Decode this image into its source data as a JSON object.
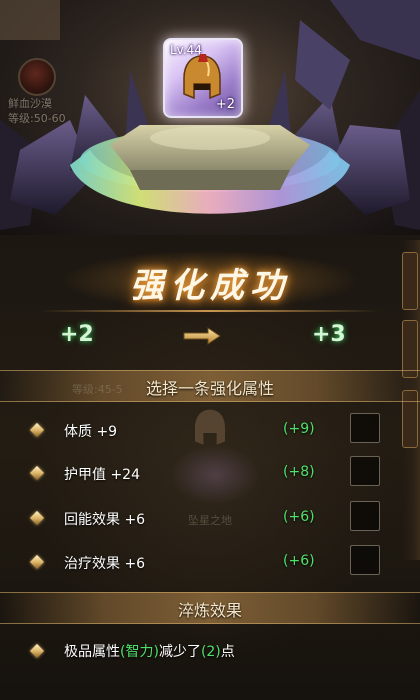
{
  "background": {
    "player_name": "鲜血沙漠",
    "player_level": "等级:50-60",
    "zone_level": "等级:45-5",
    "zone_name": "坠星之地"
  },
  "item": {
    "level": "Lv.44",
    "enhance": "+2",
    "icon": "golden-helmet-icon"
  },
  "result": {
    "title": "强化成功",
    "from": "+2",
    "to": "+3",
    "arrow_icon": "right-arrow-icon"
  },
  "select_section": {
    "title": "选择一条强化属性",
    "attributes": [
      {
        "name": "体质 +9",
        "bonus": "(+9)"
      },
      {
        "name": "护甲值 +24",
        "bonus": "(+8)"
      },
      {
        "name": "回能效果 +6",
        "bonus": "(+6)"
      },
      {
        "name": "治疗效果 +6",
        "bonus": "(+6)"
      }
    ]
  },
  "refine_section": {
    "title": "淬炼效果",
    "text_prefix": "极品属性",
    "text_attr": "(智力)",
    "text_mid": "减少了",
    "text_num": "(2)",
    "text_suffix": "点"
  },
  "colors": {
    "accent_green": "#4fe06a",
    "title_glow": "#ffb24a",
    "section_gold": "#c99650"
  }
}
